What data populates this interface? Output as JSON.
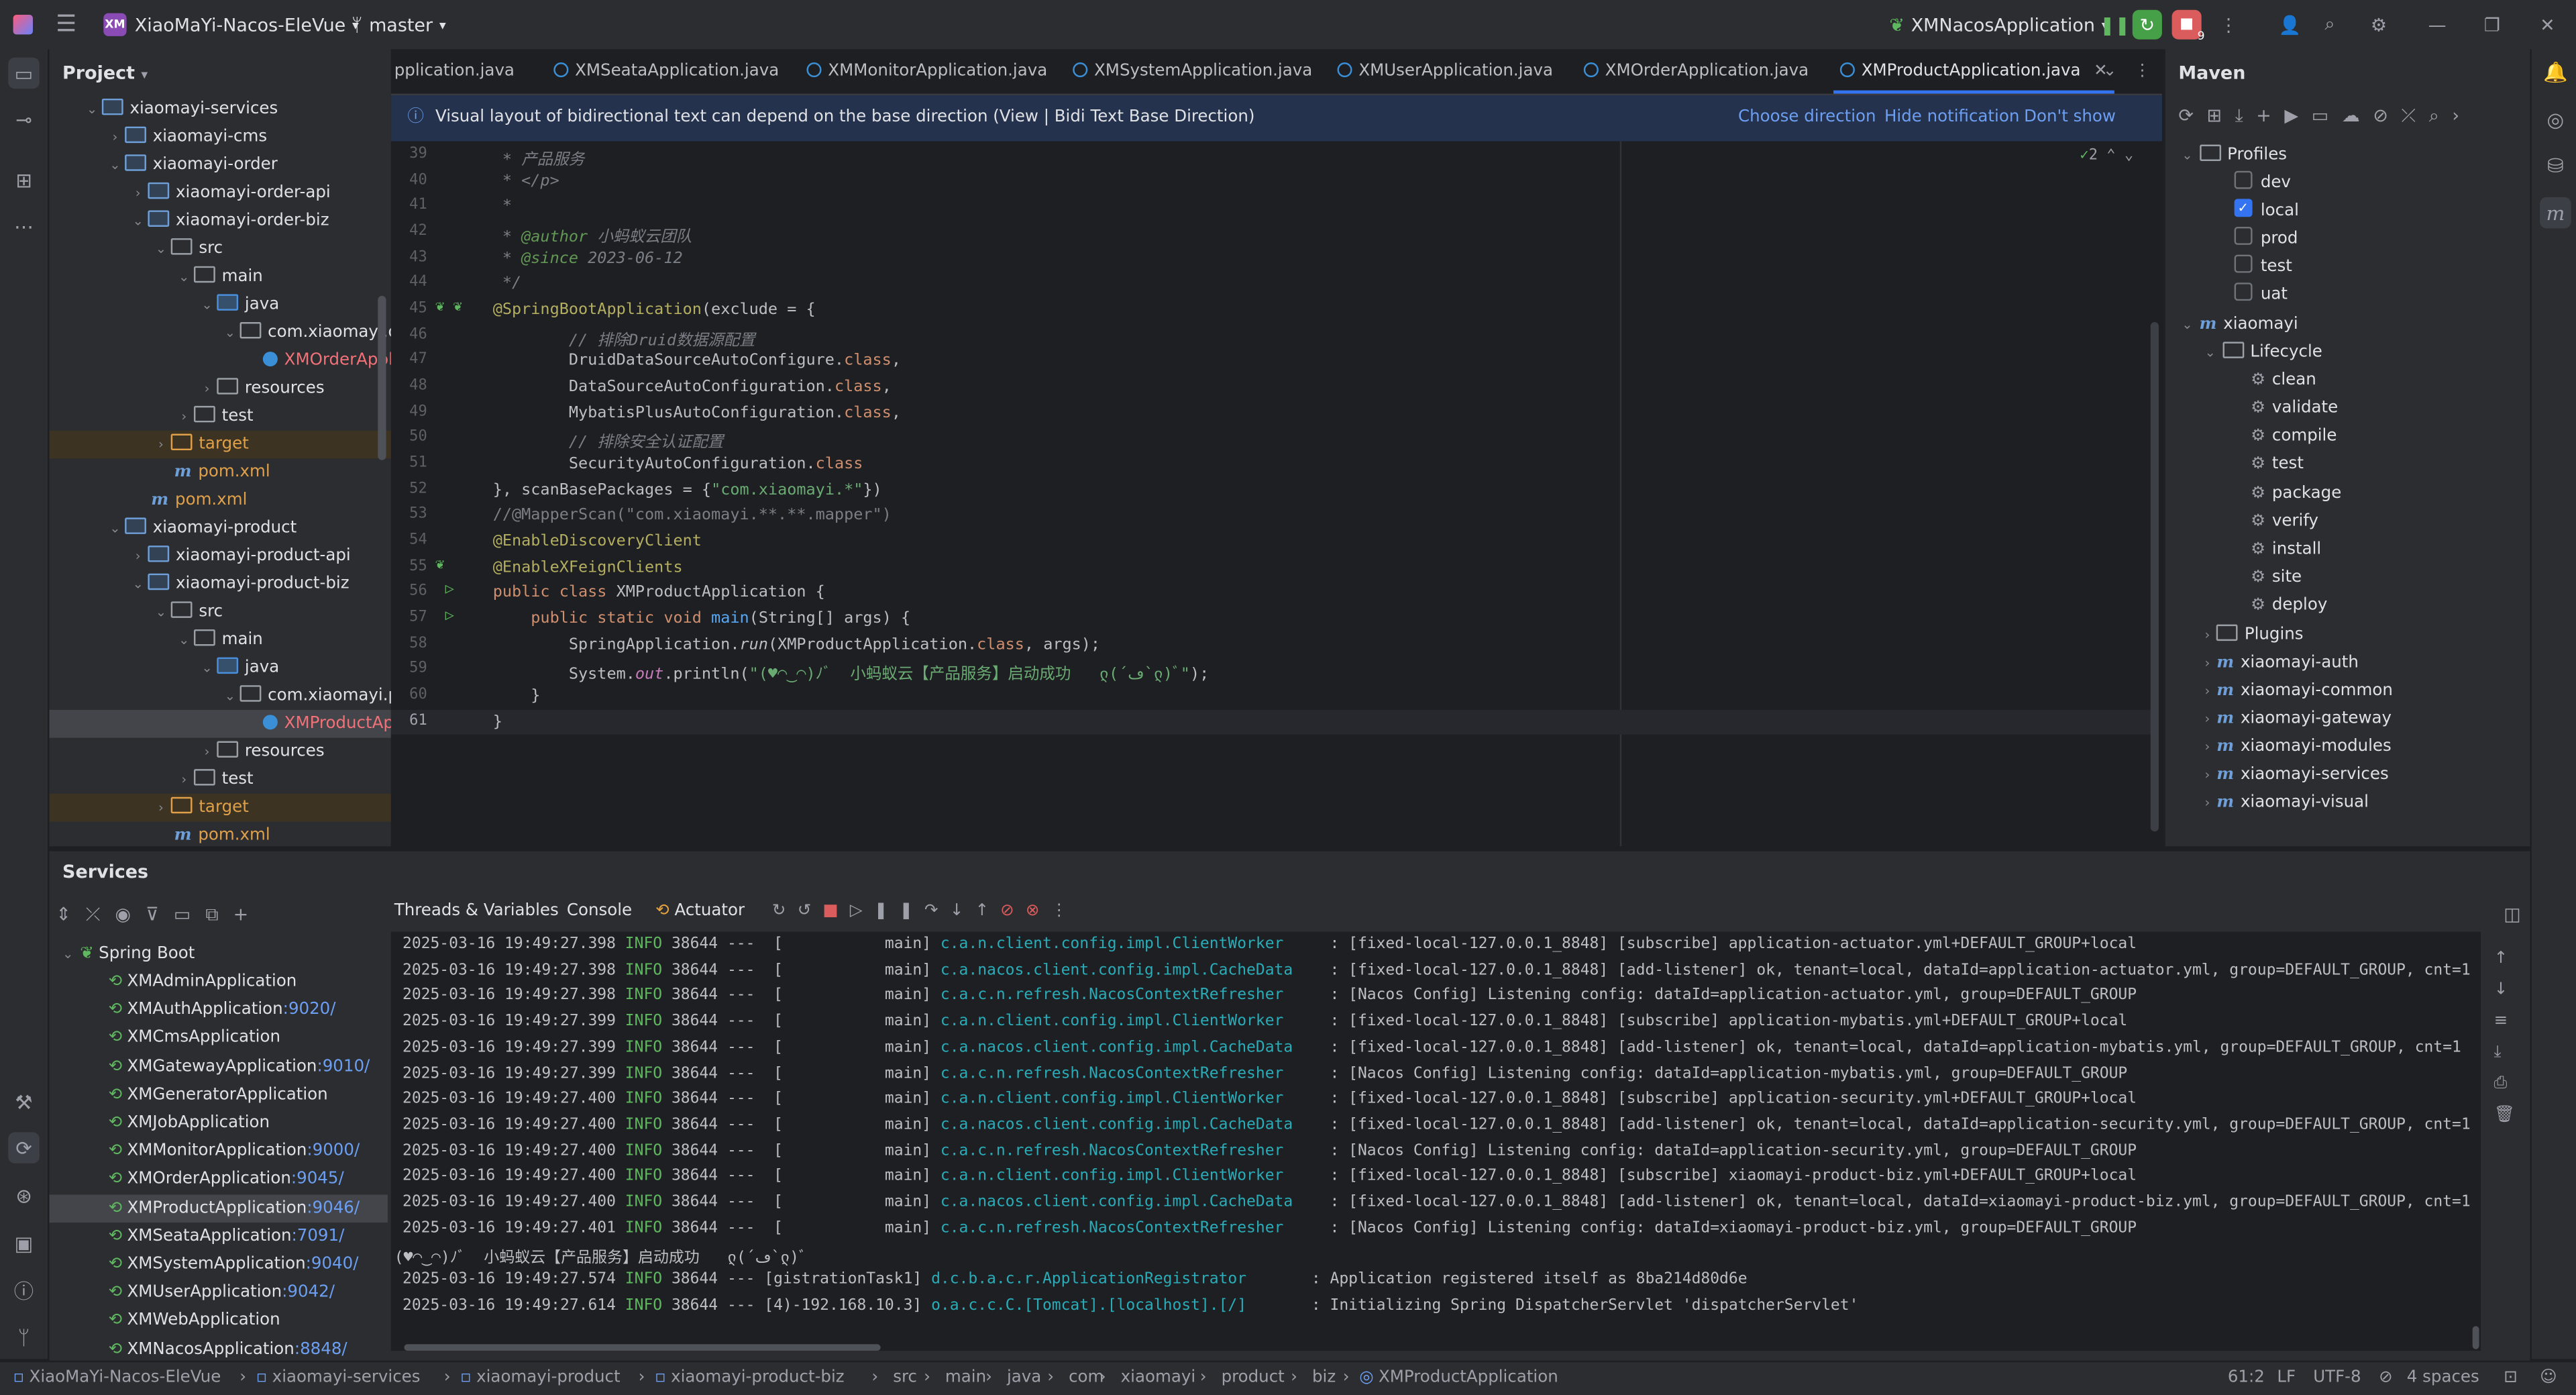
{
  "titlebar": {
    "project_badge": "XM",
    "project": "XiaoMaYi-Nacos-EleVue",
    "branch": "master",
    "run_config": "XMNacosApplication",
    "update_count": "9"
  },
  "project_panel": {
    "title": "Project",
    "rows": [
      "xiaomayi-services",
      "xiaomayi-cms",
      "xiaomayi-order",
      "xiaomayi-order-api",
      "xiaomayi-order-biz",
      "src",
      "main",
      "java",
      "com.xiaomayi.orc",
      "XMOrderAppli",
      "resources",
      "test",
      "target",
      "pom.xml",
      "pom.xml",
      "xiaomayi-product",
      "xiaomayi-product-api",
      "xiaomayi-product-biz",
      "src",
      "main",
      "java",
      "com.xiaomayi.pro",
      "XMProductApp",
      "resources",
      "test",
      "target",
      "pom.xml"
    ]
  },
  "tabs": [
    "pplication.java",
    "XMSeataApplication.java",
    "XMMonitorApplication.java",
    "XMSystemApplication.java",
    "XMUserApplication.java",
    "XMOrderApplication.java",
    "XMProductApplication.java"
  ],
  "notification": {
    "text": "Visual layout of bidirectional text can depend on the base direction (View | Bidi Text Base Direction)",
    "choose": "Choose direction",
    "hide": "Hide notification",
    "dont_show": "Don't show again"
  },
  "editor": {
    "warn_count": "2",
    "line_numbers": [
      "39",
      "40",
      "41",
      "42",
      "43",
      "44",
      "45",
      "46",
      "47",
      "48",
      "49",
      "50",
      "51",
      "52",
      "53",
      "54",
      "55",
      "56",
      "57",
      "58",
      "59",
      "60",
      "61"
    ],
    "l39": " * 产品服务",
    "l40": " * </p>",
    "l41": " *",
    "l42a": " * ",
    "l42b": "@author",
    "l42c": " 小蚂蚁云团队",
    "l43a": " * ",
    "l43b": "@since",
    "l43c": " 2023-06-12",
    "l44": " */",
    "l45a": "@SpringBootApplication",
    "l45b": "(exclude = {",
    "l46": "        // 排除Druid数据源配置",
    "l47a": "        DruidDataSourceAutoConfigure.",
    "l47b": "class",
    "l47c": ",",
    "l48a": "        DataSourceAutoConfiguration.",
    "l48b": "class",
    "l48c": ",",
    "l49a": "        MybatisPlusAutoConfiguration.",
    "l49b": "class",
    "l49c": ",",
    "l50": "        // 排除安全认证配置",
    "l51a": "        SecurityAutoConfiguration.",
    "l51b": "class",
    "l52a": "}, scanBasePackages = {",
    "l52b": "\"com.xiaomayi.*\"",
    "l52c": "})",
    "l53": "//@MapperScan(\"com.xiaomayi.**.**.mapper\")",
    "l54": "@EnableDiscoveryClient",
    "l55": "@EnableXFeignClients",
    "l56a": "public class",
    "l56b": " XMProductApplication {",
    "l57a": "    public static void",
    "l57b": " main",
    "l57c": "(String[] args) {",
    "l58a": "        SpringApplication.",
    "l58b": "run",
    "l58c": "(XMProductApplication.",
    "l58d": "class",
    "l58e": ", args);",
    "l59a": "        System.",
    "l59b": "out",
    "l59c": ".println(",
    "l59d": "\"(♥◠‿◠)ﾉﾞ  小蚂蚁云【产品服务】启动成功   ლ(´ڡ`ლ)ﾞ\"",
    "l59e": ");",
    "l60": "    }",
    "l61": "}"
  },
  "maven": {
    "title": "Maven",
    "profiles_label": "Profiles",
    "profiles": [
      {
        "name": "dev",
        "checked": false
      },
      {
        "name": "local",
        "checked": true
      },
      {
        "name": "prod",
        "checked": false
      },
      {
        "name": "test",
        "checked": false
      },
      {
        "name": "uat",
        "checked": false
      }
    ],
    "root": "xiaomayi",
    "lifecycle_label": "Lifecycle",
    "lifecycle": [
      "clean",
      "validate",
      "compile",
      "test",
      "package",
      "verify",
      "install",
      "site",
      "deploy"
    ],
    "plugins_label": "Plugins",
    "modules": [
      "xiaomayi-auth",
      "xiaomayi-common",
      "xiaomayi-gateway",
      "xiaomayi-modules",
      "xiaomayi-services",
      "xiaomayi-visual"
    ]
  },
  "services": {
    "title": "Services",
    "group": "Spring Boot",
    "apps": [
      {
        "name": "XMAdminApplication",
        "port": ""
      },
      {
        "name": "XMAuthApplication",
        "port": ":9020/"
      },
      {
        "name": "XMCmsApplication",
        "port": ""
      },
      {
        "name": "XMGatewayApplication",
        "port": ":9010/"
      },
      {
        "name": "XMGeneratorApplication",
        "port": ""
      },
      {
        "name": "XMJobApplication",
        "port": ""
      },
      {
        "name": "XMMonitorApplication",
        "port": ":9000/"
      },
      {
        "name": "XMOrderApplication",
        "port": ":9045/"
      },
      {
        "name": "XMProductApplication",
        "port": ":9046/"
      },
      {
        "name": "XMSeataApplication",
        "port": ":7091/"
      },
      {
        "name": "XMSystemApplication",
        "port": ":9040/"
      },
      {
        "name": "XMUserApplication",
        "port": ":9042/"
      },
      {
        "name": "XMWebApplication",
        "port": ""
      },
      {
        "name": "XMNacosApplication",
        "port": ":8848/"
      }
    ],
    "tabs": {
      "threads": "Threads & Variables",
      "console": "Console",
      "actuator": "Actuator"
    },
    "logs": [
      {
        "ts": "2025-03-16 19:49:27.398",
        "lvl": "INFO",
        "pid": "38644",
        "thread": "---  [           main] ",
        "logger": "c.a.n.client.config.impl.ClientWorker    ",
        "msg": " : [fixed-local-127.0.0.1_8848] [subscribe] application-actuator.yml+DEFAULT_GROUP+local"
      },
      {
        "ts": "2025-03-16 19:49:27.398",
        "lvl": "INFO",
        "pid": "38644",
        "thread": "---  [           main] ",
        "logger": "c.a.nacos.client.config.impl.CacheData   ",
        "msg": " : [fixed-local-127.0.0.1_8848] [add-listener] ok, tenant=local, dataId=application-actuator.yml, group=DEFAULT_GROUP, cnt=1"
      },
      {
        "ts": "2025-03-16 19:49:27.398",
        "lvl": "INFO",
        "pid": "38644",
        "thread": "---  [           main] ",
        "logger": "c.a.c.n.refresh.NacosContextRefresher    ",
        "msg": " : [Nacos Config] Listening config: dataId=application-actuator.yml, group=DEFAULT_GROUP"
      },
      {
        "ts": "2025-03-16 19:49:27.399",
        "lvl": "INFO",
        "pid": "38644",
        "thread": "---  [           main] ",
        "logger": "c.a.n.client.config.impl.ClientWorker    ",
        "msg": " : [fixed-local-127.0.0.1_8848] [subscribe] application-mybatis.yml+DEFAULT_GROUP+local"
      },
      {
        "ts": "2025-03-16 19:49:27.399",
        "lvl": "INFO",
        "pid": "38644",
        "thread": "---  [           main] ",
        "logger": "c.a.nacos.client.config.impl.CacheData   ",
        "msg": " : [fixed-local-127.0.0.1_8848] [add-listener] ok, tenant=local, dataId=application-mybatis.yml, group=DEFAULT_GROUP, cnt=1"
      },
      {
        "ts": "2025-03-16 19:49:27.399",
        "lvl": "INFO",
        "pid": "38644",
        "thread": "---  [           main] ",
        "logger": "c.a.c.n.refresh.NacosContextRefresher    ",
        "msg": " : [Nacos Config] Listening config: dataId=application-mybatis.yml, group=DEFAULT_GROUP"
      },
      {
        "ts": "2025-03-16 19:49:27.400",
        "lvl": "INFO",
        "pid": "38644",
        "thread": "---  [           main] ",
        "logger": "c.a.n.client.config.impl.ClientWorker    ",
        "msg": " : [fixed-local-127.0.0.1_8848] [subscribe] application-security.yml+DEFAULT_GROUP+local"
      },
      {
        "ts": "2025-03-16 19:49:27.400",
        "lvl": "INFO",
        "pid": "38644",
        "thread": "---  [           main] ",
        "logger": "c.a.nacos.client.config.impl.CacheData   ",
        "msg": " : [fixed-local-127.0.0.1_8848] [add-listener] ok, tenant=local, dataId=application-security.yml, group=DEFAULT_GROUP, cnt=1"
      },
      {
        "ts": "2025-03-16 19:49:27.400",
        "lvl": "INFO",
        "pid": "38644",
        "thread": "---  [           main] ",
        "logger": "c.a.c.n.refresh.NacosContextRefresher    ",
        "msg": " : [Nacos Config] Listening config: dataId=application-security.yml, group=DEFAULT_GROUP"
      },
      {
        "ts": "2025-03-16 19:49:27.400",
        "lvl": "INFO",
        "pid": "38644",
        "thread": "---  [           main] ",
        "logger": "c.a.n.client.config.impl.ClientWorker    ",
        "msg": " : [fixed-local-127.0.0.1_8848] [subscribe] xiaomayi-product-biz.yml+DEFAULT_GROUP+local"
      },
      {
        "ts": "2025-03-16 19:49:27.400",
        "lvl": "INFO",
        "pid": "38644",
        "thread": "---  [           main] ",
        "logger": "c.a.nacos.client.config.impl.CacheData   ",
        "msg": " : [fixed-local-127.0.0.1_8848] [add-listener] ok, tenant=local, dataId=xiaomayi-product-biz.yml, group=DEFAULT_GROUP, cnt=1"
      },
      {
        "ts": "2025-03-16 19:49:27.401",
        "lvl": "INFO",
        "pid": "38644",
        "thread": "---  [           main] ",
        "logger": "c.a.c.n.refresh.NacosContextRefresher    ",
        "msg": " : [Nacos Config] Listening config: dataId=xiaomayi-product-biz.yml, group=DEFAULT_GROUP"
      }
    ],
    "banner": "(♥◠‿◠)ﾉﾞ  小蚂蚁云【产品服务】启动成功   ლ(´ڡ`ლ)ﾞ",
    "logs2": [
      {
        "ts": "2025-03-16 19:49:27.574",
        "lvl": "INFO",
        "pid": "38644",
        "thread": "--- [gistrationTask1] ",
        "logger": "d.c.b.a.c.r.ApplicationRegistrator      ",
        "msg": " : Application registered itself as 8ba214d80d6e"
      },
      {
        "ts": "2025-03-16 19:49:27.614",
        "lvl": "INFO",
        "pid": "38644",
        "thread": "--- [4)-192.168.10.3] ",
        "logger": "o.a.c.c.C.[Tomcat].[localhost].[/]      ",
        "msg": " : Initializing Spring DispatcherServlet 'dispatcherServlet'"
      }
    ]
  },
  "statusbar": {
    "crumbs": [
      "XiaoMaYi-Nacos-EleVue",
      "xiaomayi-services",
      "xiaomayi-product",
      "xiaomayi-product-biz",
      "src",
      "main",
      "java",
      "com",
      "xiaomayi",
      "product",
      "biz",
      "XMProductApplication"
    ],
    "position": "61:2",
    "line_sep": "LF",
    "encoding": "UTF-8",
    "indent": "4 spaces"
  }
}
